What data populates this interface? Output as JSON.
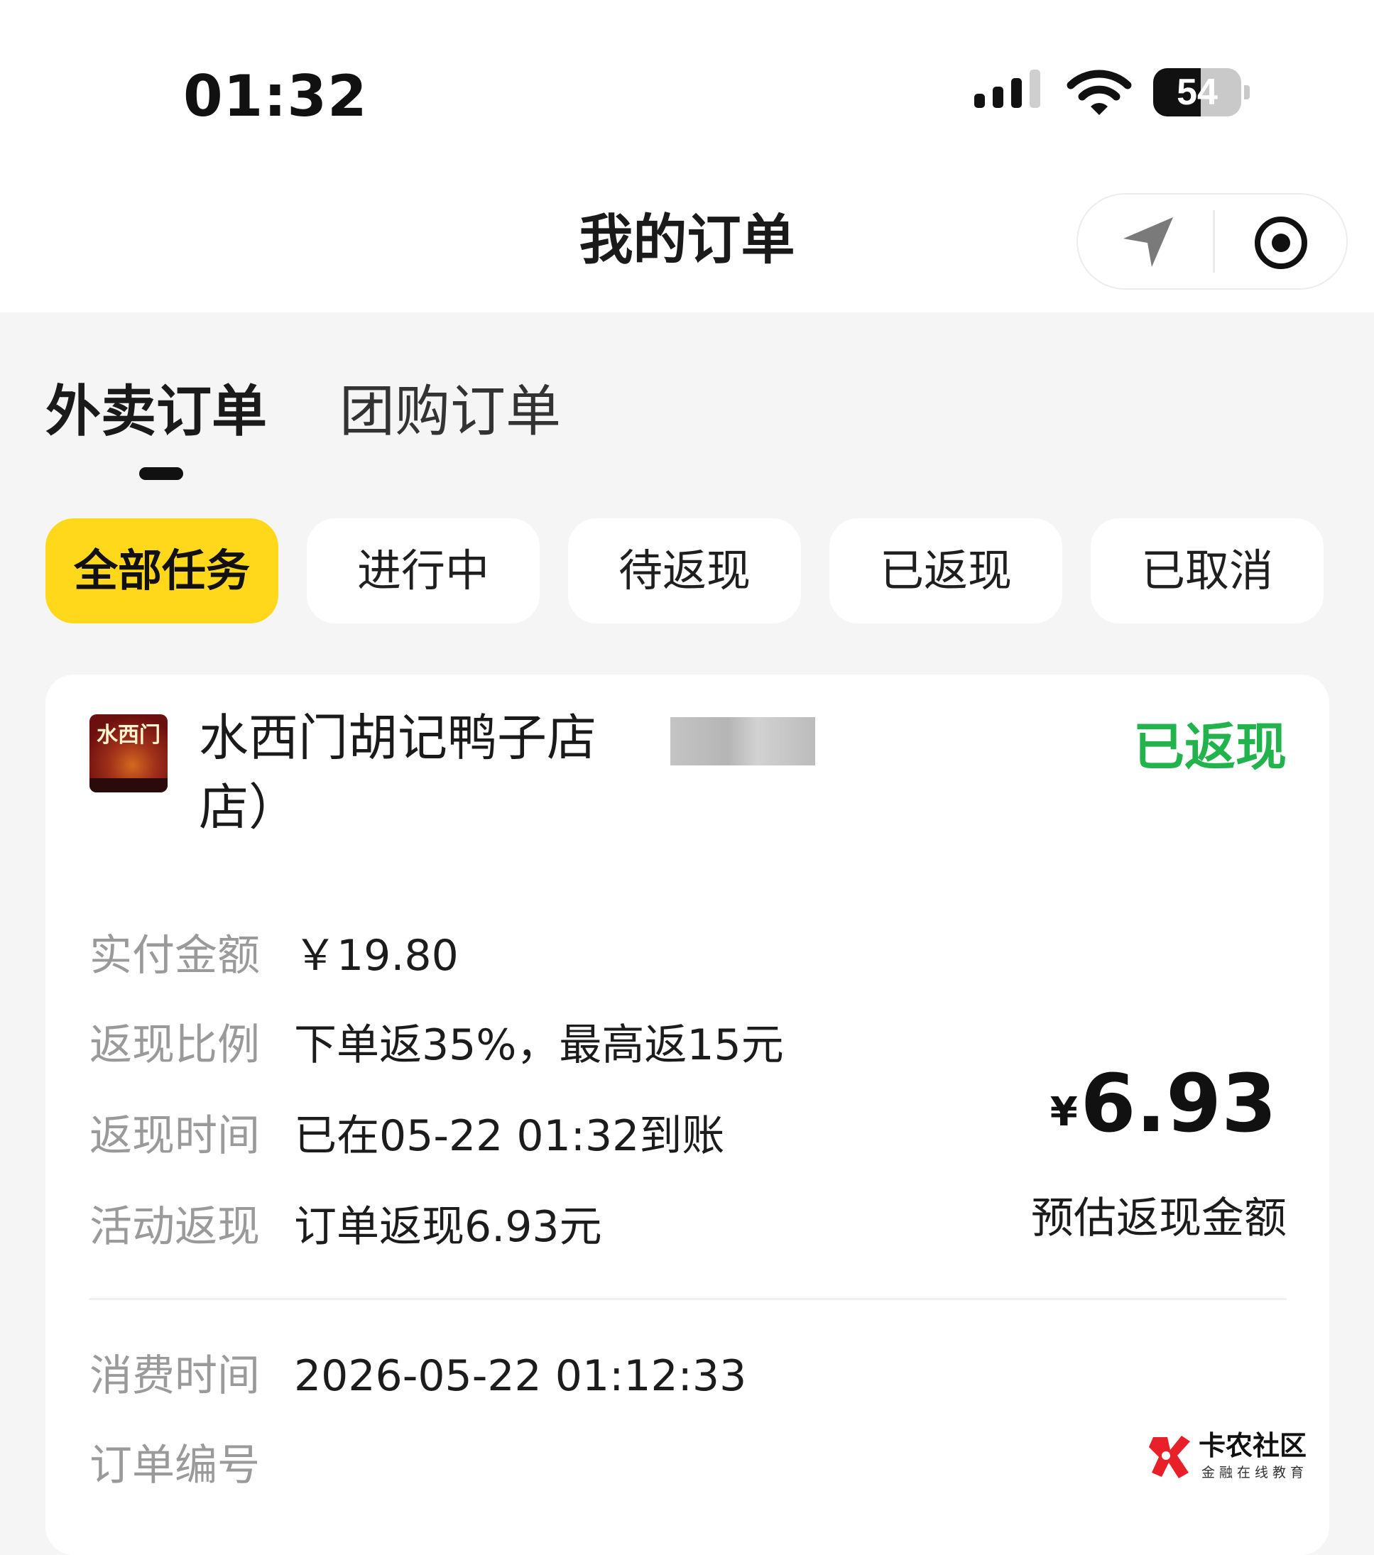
{
  "status_bar": {
    "time": "01:32",
    "battery_level": "54",
    "battery_fraction": 0.54
  },
  "header": {
    "title": "我的订单",
    "icons": [
      "location-arrow-icon",
      "target-record-icon"
    ]
  },
  "tabs": [
    {
      "label": "外卖订单",
      "active": true
    },
    {
      "label": "团购订单",
      "active": false
    }
  ],
  "filters": [
    {
      "label": "全部任务",
      "active": true
    },
    {
      "label": "进行中",
      "active": false
    },
    {
      "label": "待返现",
      "active": false
    },
    {
      "label": "已返现",
      "active": false
    },
    {
      "label": "已取消",
      "active": false
    }
  ],
  "order": {
    "store_name": "水西门胡记鸭子店",
    "store_name_line2": "店）",
    "logo_text": "水西门",
    "status": "已返现",
    "paid_label": "实付金额",
    "paid_value": "￥19.80",
    "ratio_label": "返现比例",
    "ratio_value": "下单返35%，最高返15元",
    "cashback_time_label": "返现时间",
    "cashback_time_value": "已在05-22 01:32到账",
    "activity_label": "活动返现",
    "activity_value": "订单返现6.93元",
    "cashback_currency": "¥",
    "cashback_amount": "6.93",
    "cashback_caption": "预估返现金额",
    "consume_time_label": "消费时间",
    "consume_time_value": "2026-05-22 01:12:33",
    "order_no_label": "订单编号"
  },
  "watermark": {
    "name": "卡农社区",
    "subtitle": "金融在线教育"
  },
  "colors": {
    "accent_yellow": "#ffd81c",
    "status_green": "#22b34c",
    "page_bg": "#f5f5f5",
    "label_gray": "#9a9a9a"
  }
}
